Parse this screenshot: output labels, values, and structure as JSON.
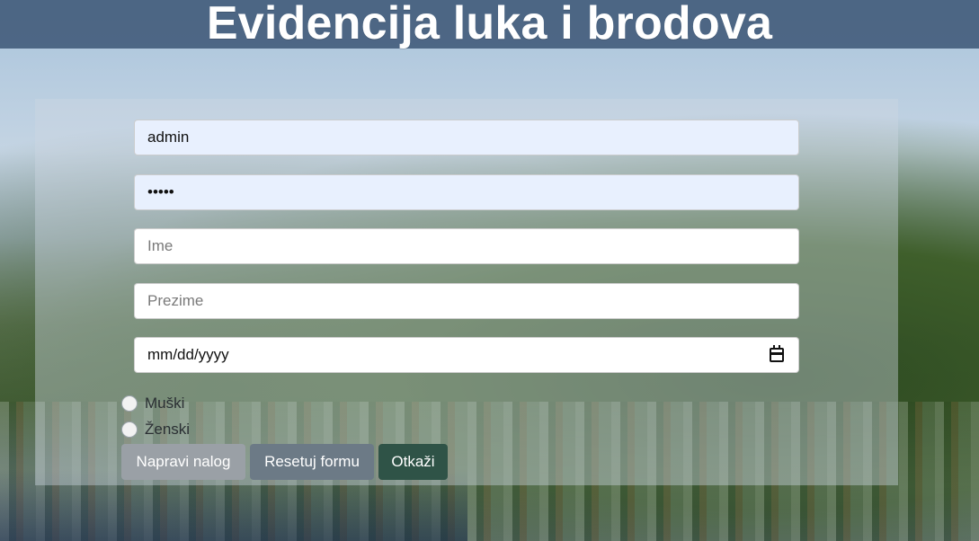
{
  "header": {
    "title": "Evidencija luka i brodova"
  },
  "form": {
    "fields": {
      "username": {
        "value": "admin",
        "placeholder": ""
      },
      "password": {
        "value": "•••••",
        "placeholder": ""
      },
      "first_name": {
        "value": "",
        "placeholder": "Ime"
      },
      "last_name": {
        "value": "",
        "placeholder": "Prezime"
      },
      "birth_date": {
        "value": "mm/dd/yyyy",
        "placeholder": "mm/dd/yyyy"
      }
    },
    "gender": {
      "options": [
        {
          "label": "Muški",
          "selected": false
        },
        {
          "label": "Ženski",
          "selected": false
        }
      ]
    },
    "buttons": {
      "create": "Napravi nalog",
      "reset": "Resetuj formu",
      "cancel": "Otkaži"
    }
  },
  "icons": {
    "calendar": "calendar-icon"
  },
  "colors": {
    "header_bg": "#3d5676",
    "panel_overlay": "#cdd7e2",
    "autofill_bg": "#e8f0fe",
    "btn_create": "#9aa0a6",
    "btn_reset": "#6c7a86",
    "btn_cancel": "#2f5347"
  }
}
